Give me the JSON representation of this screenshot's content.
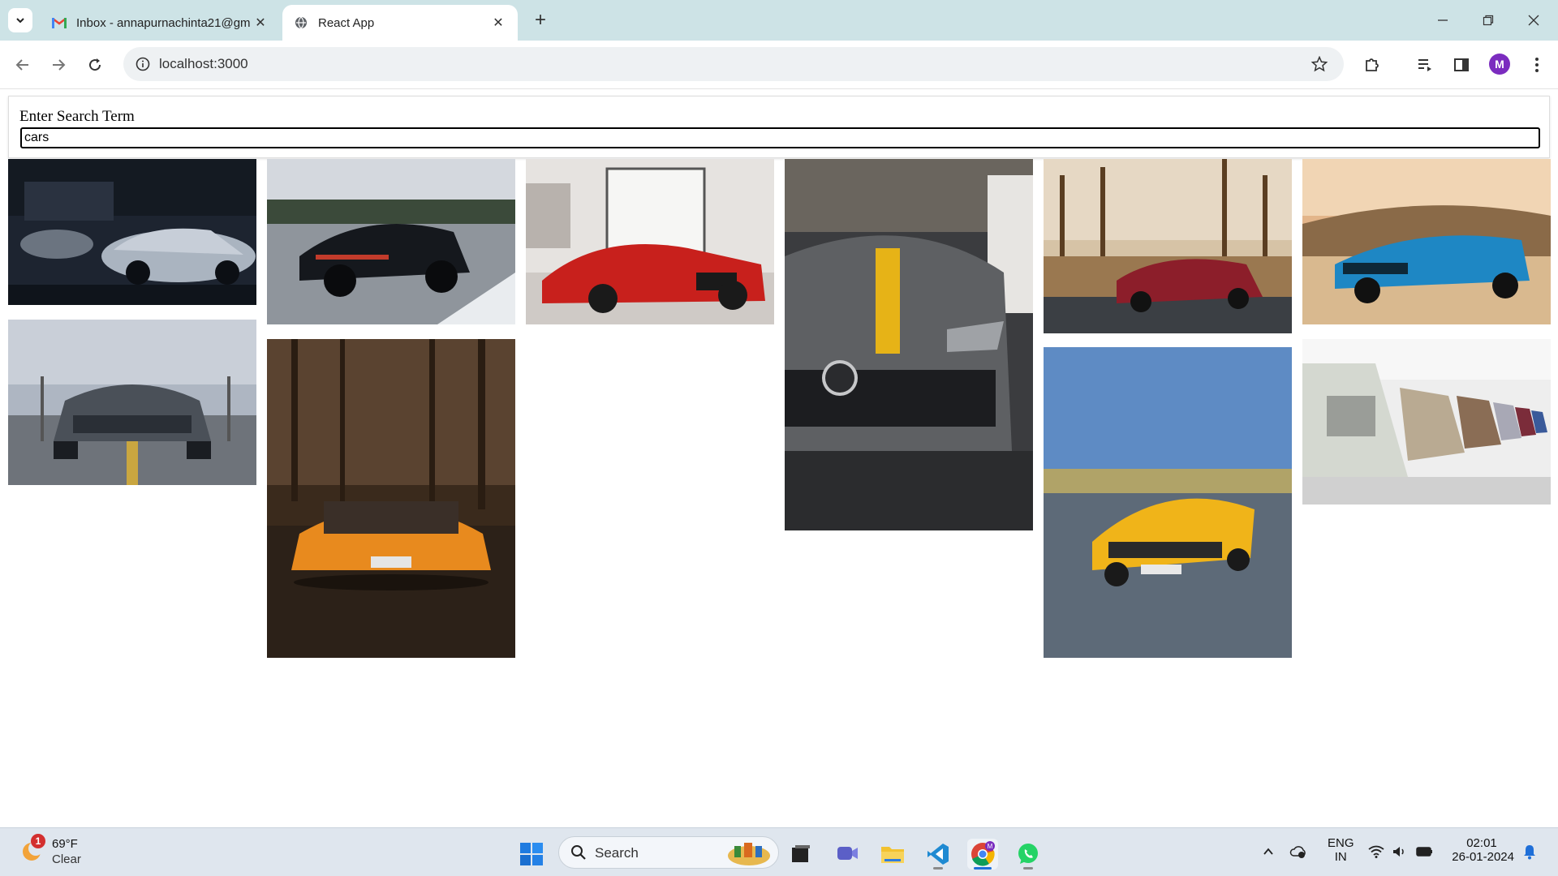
{
  "browser": {
    "tabs": [
      {
        "title": "Inbox - annapurnachinta21@gm",
        "active": false,
        "icon": "gmail-icon"
      },
      {
        "title": "React App",
        "active": true,
        "icon": "globe-icon"
      }
    ],
    "url": "localhost:3000",
    "profile_initial": "M"
  },
  "page": {
    "search_label": "Enter Search Term",
    "search_value": "cars",
    "images": [
      {
        "subject": "silver camaro in dark garage"
      },
      {
        "subject": "black porsche on highway"
      },
      {
        "subject": "red ferrari in showroom"
      },
      {
        "subject": "grey mercedes with yellow stripe"
      },
      {
        "subject": "red mercedes amg in forest"
      },
      {
        "subject": "blue camaro in desert"
      },
      {
        "subject": "grey mustang on road"
      },
      {
        "subject": "orange lamborghini in woods"
      },
      {
        "subject": "yellow mercedes amg gt on track"
      },
      {
        "subject": "row of classic bmw cars"
      }
    ]
  },
  "taskbar": {
    "weather_temp": "69°F",
    "weather_cond": "Clear",
    "weather_badge": "1",
    "search_placeholder": "Search",
    "lang_top": "ENG",
    "lang_bottom": "IN",
    "time": "02:01",
    "date": "26-01-2024"
  }
}
